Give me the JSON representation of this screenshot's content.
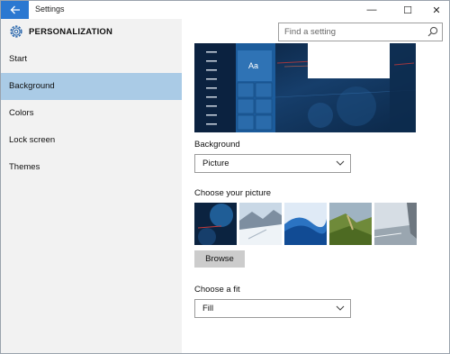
{
  "window": {
    "title": "Settings",
    "controls": {
      "minimize": "—",
      "maximize": "☐",
      "close": "✕"
    }
  },
  "sidebar": {
    "header": "PERSONALIZATION",
    "header_icon": "gear-icon",
    "items": [
      {
        "label": "Start",
        "active": false
      },
      {
        "label": "Background",
        "active": true
      },
      {
        "label": "Colors",
        "active": false
      },
      {
        "label": "Lock screen",
        "active": false
      },
      {
        "label": "Themes",
        "active": false
      }
    ]
  },
  "search": {
    "placeholder": "Find a setting",
    "icon": "search-icon"
  },
  "preview": {
    "sample_text": "Aa"
  },
  "background": {
    "label": "Background",
    "value": "Picture"
  },
  "picture": {
    "label": "Choose your picture",
    "thumbnails": [
      "space-blue",
      "snowy-mountains",
      "blue-waves",
      "green-cliffs",
      "coast-rocks"
    ],
    "browse_label": "Browse"
  },
  "fit": {
    "label": "Choose a fit",
    "value": "Fill"
  },
  "colors": {
    "accent": "#2b78d1",
    "selected_nav": "#aacbe6",
    "sidebar_bg": "#f2f2f2"
  }
}
